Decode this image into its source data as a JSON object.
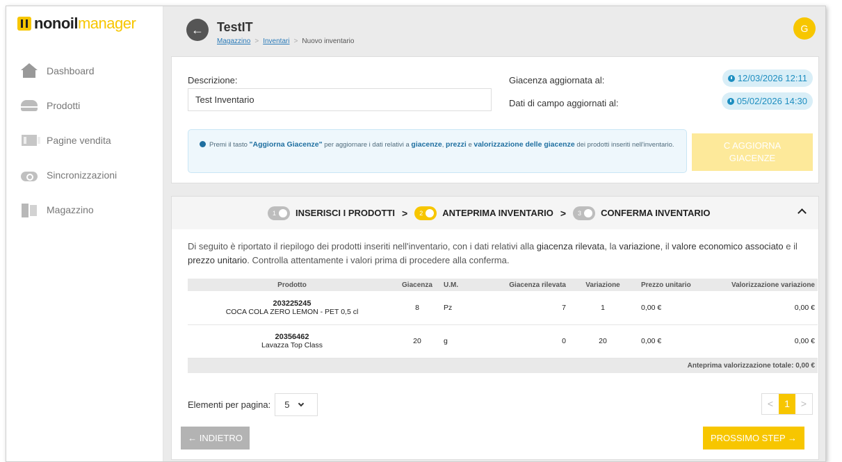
{
  "app": {
    "logo_part1": "nonoil",
    "logo_part2": "manager"
  },
  "sidebar": {
    "items": [
      {
        "label": "Dashboard",
        "icon": "house-icon"
      },
      {
        "label": "Prodotti",
        "icon": "product-icon"
      },
      {
        "label": "Pagine vendita",
        "icon": "sales-page-icon"
      },
      {
        "label": "Sincronizzazioni",
        "icon": "sync-icon"
      },
      {
        "label": "Magazzino",
        "icon": "warehouse-icon"
      }
    ]
  },
  "header": {
    "title": "TestIT",
    "breadcrumb": [
      "Magazzino",
      "Inventari",
      "Nuovo inventario"
    ],
    "avatar_initial": "G"
  },
  "form": {
    "descrizione_label": "Descrizione:",
    "descrizione_value": "Test Inventario",
    "giacenza_label": "Giacenza aggiornata al:",
    "giacenza_date": "12/03/2026 12:11",
    "dati_label": "Dati di campo aggiornati al:",
    "dati_date": "05/02/2026 14:30",
    "info_pre": "Premi il tasto ",
    "info_btn": "\"Aggiorna Giacenze\"",
    "info_mid1": " per aggiornare i dati relativi a ",
    "info_giacenze": "giacenze",
    "info_sep": ", ",
    "info_prezzi": "prezzi",
    "info_e": " e ",
    "info_valorizzazione": "valorizzazione delle giacenze",
    "info_post": " dei prodotti inseriti nell'inventario.",
    "aggiorna_line1": "C AGGIORNA",
    "aggiorna_line2": "GIACENZE"
  },
  "stepper": {
    "steps": [
      {
        "num": "1",
        "label": "INSERISCI I PRODOTTI"
      },
      {
        "num": "2",
        "label": "ANTEPRIMA INVENTARIO"
      },
      {
        "num": "3",
        "label": "CONFERMA INVENTARIO"
      }
    ],
    "chevron": ">"
  },
  "intro": {
    "t1": "Di seguito è riportato il riepilogo dei prodotti inseriti nell'inventario, con i dati relativi alla ",
    "b1": "giacenza rilevata",
    "t2": ", la ",
    "b2": "variazione",
    "t3": ", il ",
    "b3": "valore economico associato",
    "t4": " e il ",
    "b4": "prezzo unitario",
    "t5": ". Controlla attentamente i valori prima di procedere alla conferma."
  },
  "table": {
    "headers": [
      "Prodotto",
      "Giacenza",
      "U.M.",
      "Giacenza rilevata",
      "Variazione",
      "Prezzo unitario",
      "Valorizzazione variazione"
    ],
    "rows": [
      {
        "code": "203225245",
        "name": "COCA COLA ZERO LEMON - PET 0,5 cl",
        "giacenza": "8",
        "um": "Pz",
        "rilevata": "7",
        "variazione": "1",
        "prezzo": "0,00 €",
        "valorizzazione": "0,00 €"
      },
      {
        "code": "20356462",
        "name": "Lavazza Top Class",
        "giacenza": "20",
        "um": "g",
        "rilevata": "0",
        "variazione": "20",
        "prezzo": "0,00 €",
        "valorizzazione": "0,00 €"
      }
    ],
    "total": "Anteprima valorizzazione totale: 0,00 €"
  },
  "pagination": {
    "per_page_label": "Elementi per pagina:",
    "per_page_value": "5",
    "prev": "<",
    "current": "1",
    "next": ">"
  },
  "buttons": {
    "back": "← INDIETRO",
    "next": "PROSSIMO STEP →"
  },
  "colors": {
    "accent": "#f7c600",
    "info": "#1e8ec0",
    "back_button": "#b3b3b3"
  }
}
